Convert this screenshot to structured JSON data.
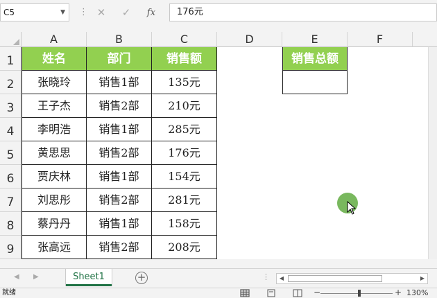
{
  "formula_bar": {
    "name_box": "C5",
    "formula": "176元",
    "cancel_icon": "close-icon",
    "enter_icon": "check-icon",
    "function_label": "fx"
  },
  "columns": [
    "A",
    "B",
    "C",
    "D",
    "E",
    "F"
  ],
  "rows": [
    "1",
    "2",
    "3",
    "4",
    "5",
    "6",
    "7",
    "8",
    "9"
  ],
  "table": {
    "headers": [
      "姓名",
      "部门",
      "销售额"
    ],
    "rows": [
      [
        "张晓玲",
        "销售1部",
        "135元"
      ],
      [
        "王子杰",
        "销售2部",
        "210元"
      ],
      [
        "李明浩",
        "销售1部",
        "285元"
      ],
      [
        "黄思思",
        "销售2部",
        "176元"
      ],
      [
        "贾庆林",
        "销售1部",
        "154元"
      ],
      [
        "刘思彤",
        "销售2部",
        "281元"
      ],
      [
        "蔡丹丹",
        "销售1部",
        "158元"
      ],
      [
        "张高远",
        "销售2部",
        "208元"
      ]
    ]
  },
  "summary": {
    "header": "销售总额",
    "value": ""
  },
  "sheet_tabs": {
    "active": "Sheet1",
    "add_icon": "plus-circle-icon"
  },
  "status_bar": {
    "status": "就绪",
    "zoom_level": "130%"
  },
  "colors": {
    "header_fill": "#92d050",
    "header_text": "#ffffff",
    "accent": "#217346",
    "cursor_dot": "#6ab04c"
  }
}
